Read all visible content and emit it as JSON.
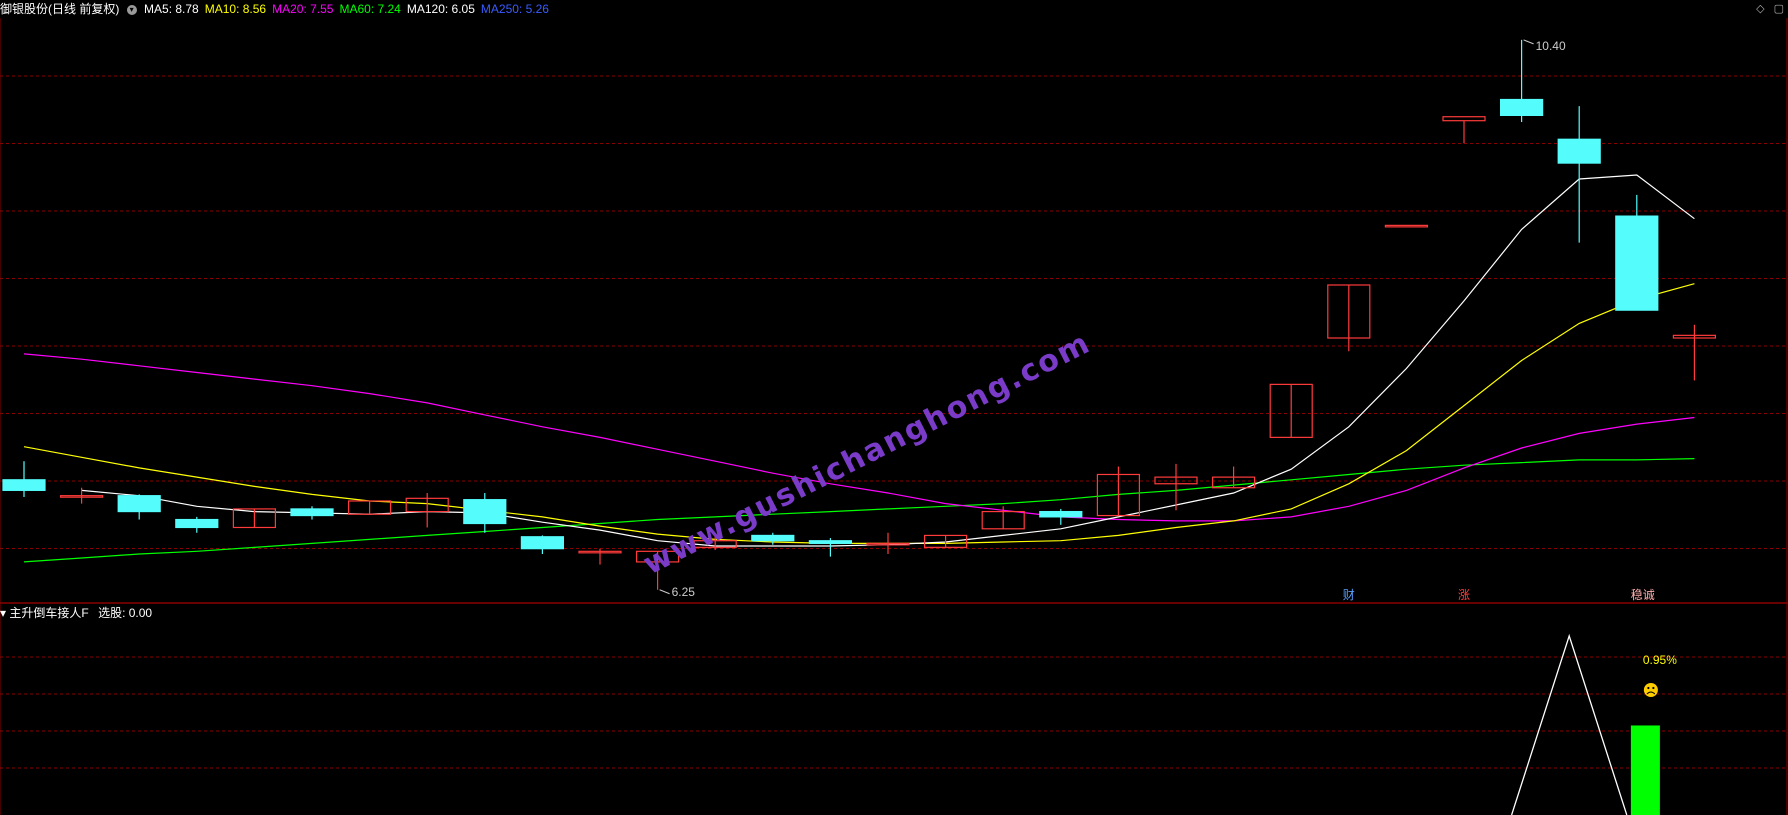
{
  "header": {
    "title": "御银股份(日线 前复权)",
    "ma_labels": [
      {
        "label": "MA5: 8.78",
        "color": "#ffffff"
      },
      {
        "label": "MA10: 8.56",
        "color": "#ffff00"
      },
      {
        "label": "MA20: 7.55",
        "color": "#ff00ff"
      },
      {
        "label": "MA60: 7.24",
        "color": "#00ff00"
      },
      {
        "label": "MA120: 6.05",
        "color": "#ffffff"
      },
      {
        "label": "MA250: 5.26",
        "color": "#3a5cff"
      }
    ]
  },
  "sub_header": {
    "indicator_name": "主升倒车接人F",
    "value_label": "选股: 0.00"
  },
  "colors": {
    "up": "#ff3b3b",
    "down": "#54fcfc",
    "grid": "#8b0000",
    "ma5": "#ffffff",
    "ma10": "#ffff00",
    "ma20": "#ff00ff",
    "ma60": "#00ff00",
    "watermark": "#7a3cc8",
    "bar": "#00ff00"
  },
  "chart_data": [
    {
      "type": "candlestick",
      "x": [
        1,
        2,
        3,
        4,
        5,
        6,
        7,
        8,
        9,
        10,
        11,
        12,
        13,
        14,
        15,
        16,
        17,
        18,
        19,
        20,
        21,
        22,
        23,
        24,
        25,
        26,
        27,
        28,
        29,
        30
      ],
      "candles": [
        {
          "o": 7.08,
          "h": 7.22,
          "l": 6.95,
          "c": 7.0
        },
        {
          "o": 6.96,
          "h": 7.02,
          "l": 6.9,
          "c": 6.96
        },
        {
          "o": 6.96,
          "h": 6.97,
          "l": 6.78,
          "c": 6.84
        },
        {
          "o": 6.78,
          "h": 6.8,
          "l": 6.68,
          "c": 6.72
        },
        {
          "o": 6.72,
          "h": 6.86,
          "l": 6.72,
          "c": 6.86
        },
        {
          "o": 6.86,
          "h": 6.88,
          "l": 6.78,
          "c": 6.81
        },
        {
          "o": 6.82,
          "h": 6.92,
          "l": 6.82,
          "c": 6.92
        },
        {
          "o": 6.84,
          "h": 6.98,
          "l": 6.72,
          "c": 6.94
        },
        {
          "o": 6.93,
          "h": 6.98,
          "l": 6.68,
          "c": 6.75
        },
        {
          "o": 6.65,
          "h": 6.66,
          "l": 6.52,
          "c": 6.56
        },
        {
          "o": 6.54,
          "h": 6.56,
          "l": 6.44,
          "c": 6.54
        },
        {
          "o": 6.46,
          "h": 6.54,
          "l": 6.25,
          "c": 6.54
        },
        {
          "o": 6.57,
          "h": 6.66,
          "l": 6.55,
          "c": 6.62
        },
        {
          "o": 6.66,
          "h": 6.68,
          "l": 6.59,
          "c": 6.62
        },
        {
          "o": 6.62,
          "h": 6.64,
          "l": 6.5,
          "c": 6.6
        },
        {
          "o": 6.6,
          "h": 6.68,
          "l": 6.52,
          "c": 6.6
        },
        {
          "o": 6.57,
          "h": 6.66,
          "l": 6.57,
          "c": 6.66
        },
        {
          "o": 6.71,
          "h": 6.88,
          "l": 6.71,
          "c": 6.84
        },
        {
          "o": 6.84,
          "h": 6.86,
          "l": 6.74,
          "c": 6.8
        },
        {
          "o": 6.81,
          "h": 7.18,
          "l": 6.81,
          "c": 7.12
        },
        {
          "o": 7.05,
          "h": 7.2,
          "l": 6.85,
          "c": 7.1
        },
        {
          "o": 7.02,
          "h": 7.18,
          "l": 7.02,
          "c": 7.1
        },
        {
          "o": 7.4,
          "h": 7.8,
          "l": 7.4,
          "c": 7.8
        },
        {
          "o": 8.15,
          "h": 8.55,
          "l": 8.05,
          "c": 8.55
        },
        {
          "o": 9.0,
          "h": 9.0,
          "l": 9.0,
          "c": 9.0
        },
        {
          "o": 9.79,
          "h": 9.79,
          "l": 9.62,
          "c": 9.82
        },
        {
          "o": 9.95,
          "h": 10.4,
          "l": 9.78,
          "c": 9.83
        },
        {
          "o": 9.65,
          "h": 9.9,
          "l": 8.87,
          "c": 9.47
        },
        {
          "o": 9.07,
          "h": 9.23,
          "l": 8.37,
          "c": 8.36
        },
        {
          "o": 8.15,
          "h": 8.25,
          "l": 7.83,
          "c": 8.17
        }
      ],
      "ma5": [
        null,
        7.0,
        6.96,
        6.88,
        6.84,
        6.83,
        6.82,
        6.84,
        6.83,
        6.76,
        6.7,
        6.62,
        6.58,
        6.58,
        6.58,
        6.59,
        6.61,
        6.66,
        6.71,
        6.8,
        6.89,
        6.98,
        7.16,
        7.48,
        7.92,
        8.43,
        8.97,
        9.35,
        9.38,
        9.05
      ],
      "ma10": [
        7.33,
        7.25,
        7.17,
        7.1,
        7.03,
        6.97,
        6.92,
        6.9,
        6.85,
        6.8,
        6.73,
        6.67,
        6.63,
        6.61,
        6.6,
        6.6,
        6.6,
        6.61,
        6.62,
        6.66,
        6.72,
        6.77,
        6.86,
        7.05,
        7.3,
        7.64,
        7.98,
        8.26,
        8.44,
        8.56
      ],
      "ma20": [
        8.03,
        7.99,
        7.94,
        7.89,
        7.84,
        7.79,
        7.73,
        7.66,
        7.57,
        7.48,
        7.4,
        7.31,
        7.22,
        7.13,
        7.05,
        6.98,
        6.9,
        6.85,
        6.8,
        6.78,
        6.77,
        6.77,
        6.8,
        6.88,
        7.0,
        7.17,
        7.32,
        7.43,
        7.5,
        7.55
      ],
      "ma60": [
        6.46,
        6.49,
        6.52,
        6.54,
        6.57,
        6.6,
        6.63,
        6.66,
        6.69,
        6.72,
        6.75,
        6.78,
        6.8,
        6.82,
        6.84,
        6.86,
        6.88,
        6.9,
        6.93,
        6.97,
        7.0,
        7.04,
        7.08,
        7.12,
        7.16,
        7.19,
        7.21,
        7.23,
        7.23,
        7.24
      ],
      "annotations": [
        {
          "text": "6.25",
          "x": 12,
          "y": 6.25
        },
        {
          "text": "10.40",
          "x": 27,
          "y": 10.4
        },
        {
          "text": "财",
          "x": 24,
          "color": "#5aa0ff"
        },
        {
          "text": "涨",
          "x": 26,
          "color": "#ff4040"
        },
        {
          "text": "稳诚",
          "x": 29,
          "color": "#ffb0b0"
        }
      ],
      "watermark": "www.gushichanghong.com",
      "ylim": [
        6.15,
        10.55
      ],
      "grid": true
    },
    {
      "type": "line",
      "name": "主升倒车接人F",
      "x": [
        27,
        28,
        29,
        30
      ],
      "values": [
        0.0,
        0.3,
        0.0,
        null
      ],
      "bar": {
        "x": 29.8,
        "value": 0.15
      },
      "label": "0.95%",
      "ylim": [
        0,
        0.32
      ]
    }
  ]
}
